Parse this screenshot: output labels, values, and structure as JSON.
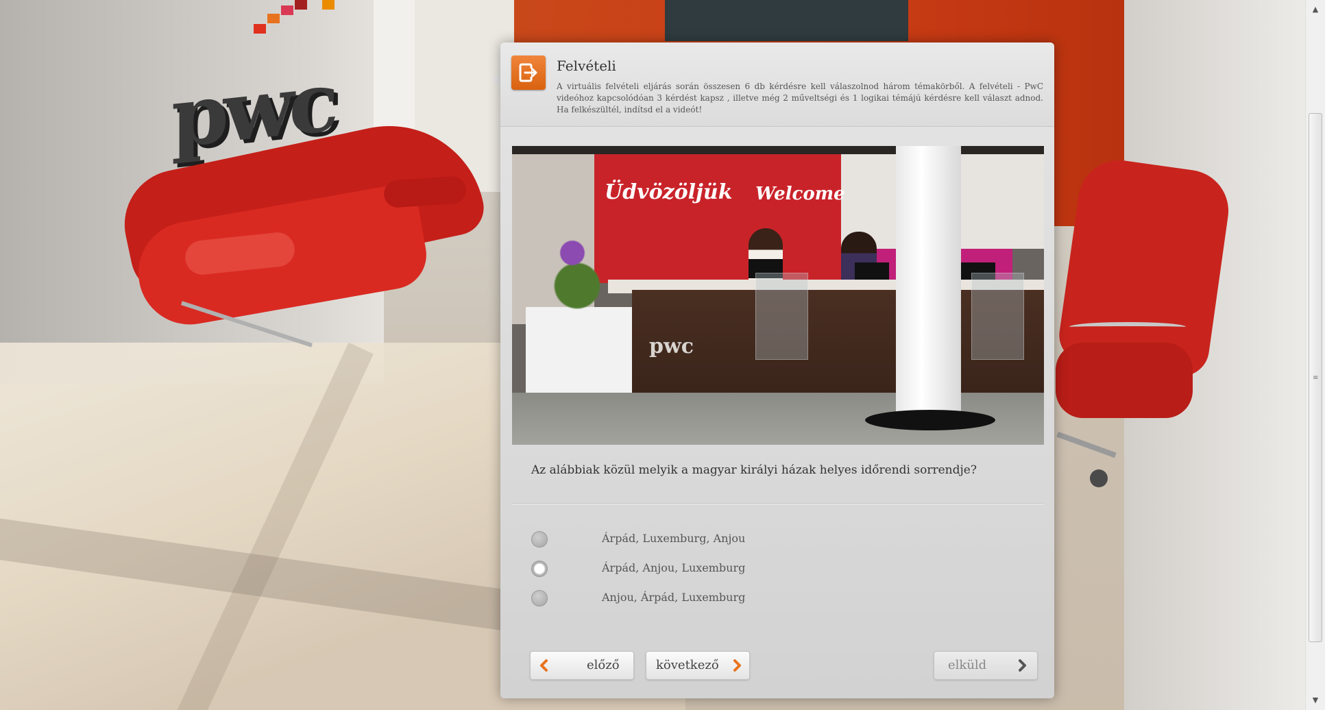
{
  "dialog": {
    "title": "Felvételi",
    "description": "A virtuális felvételi eljárás során összesen 6 db kérdésre kell válaszolnod három témakörből. A felvételi - PwC videóhoz kapcsolódóan 3 kérdést kapsz , illetve még 2 műveltségi és 1 logikai témájú kérdésre kell választ adnod. Ha felkészültél, indítsd el a videót!",
    "icon": "exit-icon",
    "accent_color": "#e8731f"
  },
  "video": {
    "sign_hu": "Üdvözöljük",
    "sign_en": "Welcome",
    "desk_logo": "pwc"
  },
  "background": {
    "wall_logo": "pwc"
  },
  "question": {
    "text": "Az alábbiak közül melyik a magyar királyi házak helyes időrendi sorrendje?",
    "options": [
      {
        "label": "Árpád, Luxemburg, Anjou",
        "selected": false
      },
      {
        "label": "Árpád, Anjou, Luxemburg",
        "selected": true
      },
      {
        "label": "Anjou, Árpád, Luxemburg",
        "selected": false
      }
    ]
  },
  "nav": {
    "prev_label": "előző",
    "next_label": "következő",
    "submit_label": "elküld",
    "submit_enabled": false
  },
  "scrollbar": {
    "up_arrow": "▲",
    "down_arrow": "▼",
    "grip": "≡"
  }
}
